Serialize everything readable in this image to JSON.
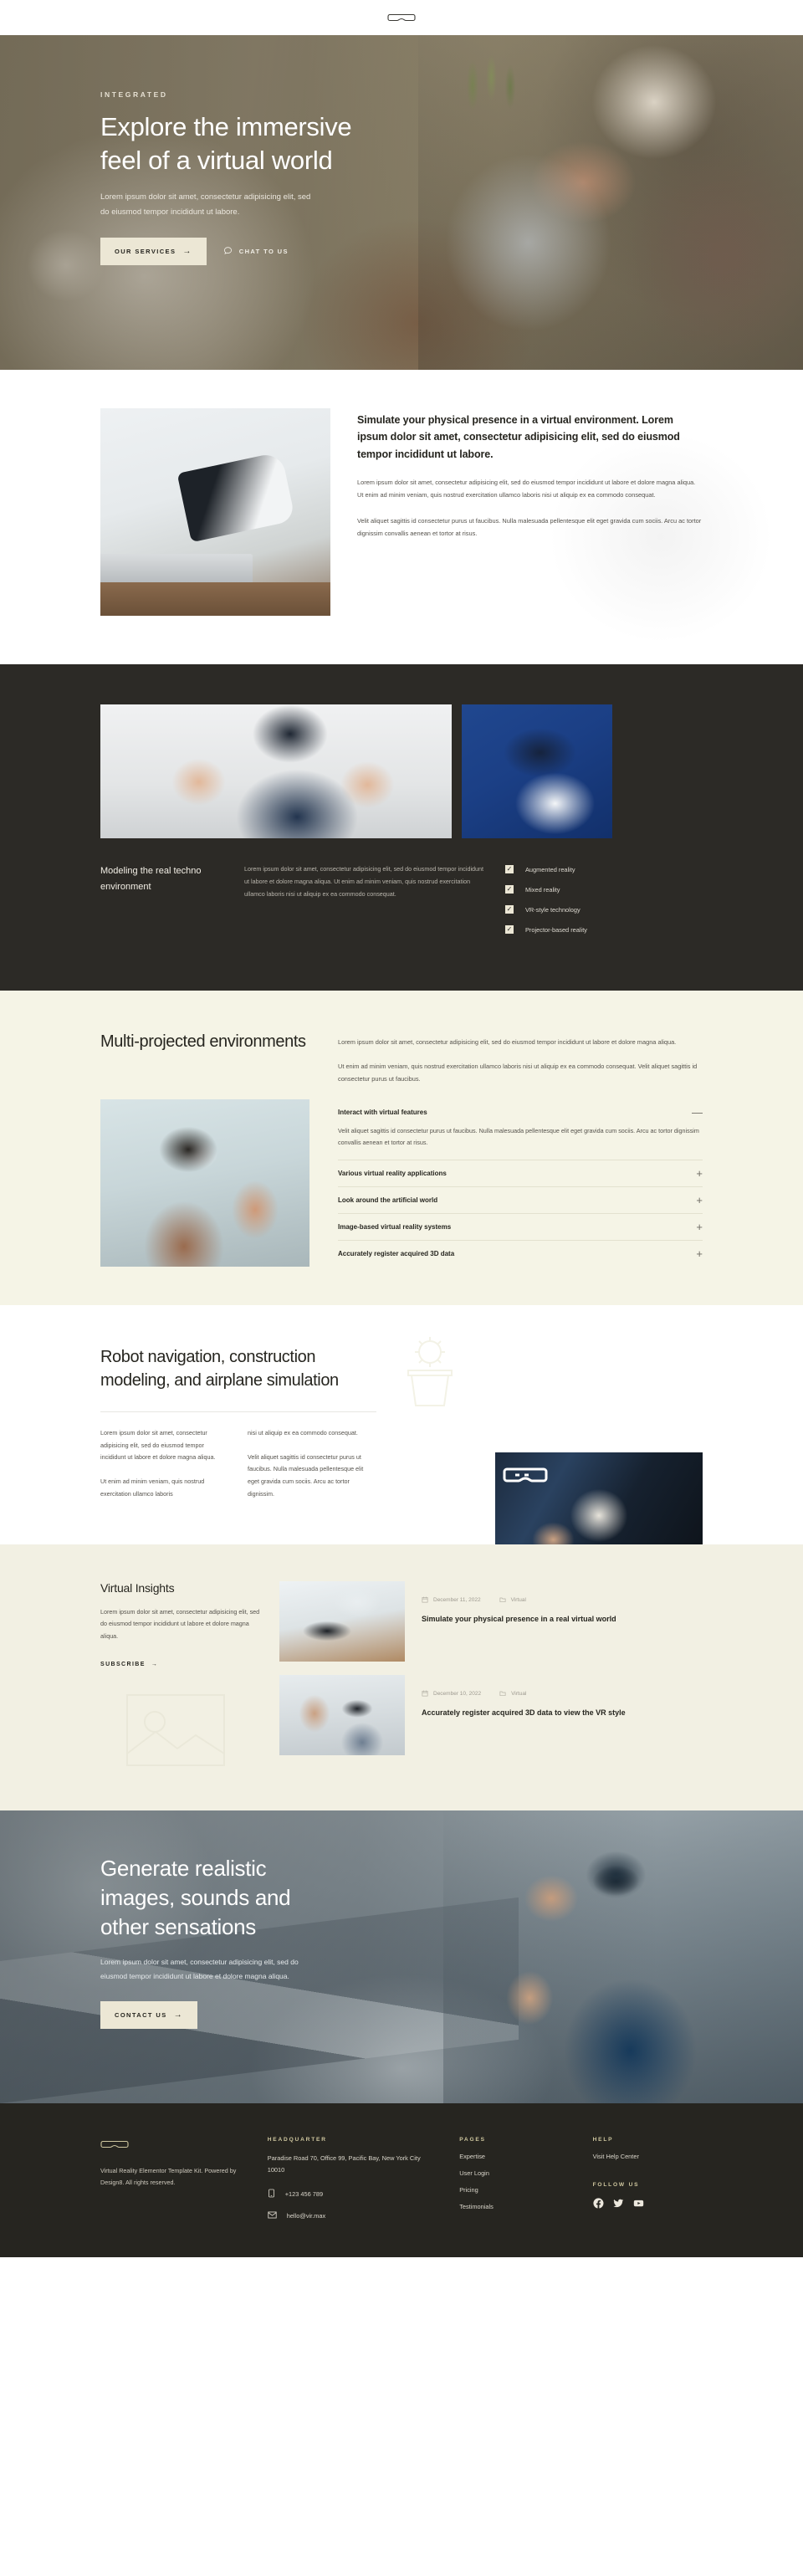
{
  "nav": {
    "logo_icon": "vr-goggles-icon"
  },
  "hero": {
    "eyebrow": "INTEGRATED",
    "title": "Explore the immersive feel of a virtual world",
    "lead": "Lorem ipsum dolor sit amet, consectetur adipisicing elit, sed do eiusmod tempor incididunt ut labore.",
    "primary_button": "OUR SERVICES",
    "chat_label": "CHAT TO US",
    "arrow_icon": "arrow-right-icon",
    "chat_icon": "chat-bubble-icon",
    "button_bg": "#ece7d5"
  },
  "simulate": {
    "heading": "Simulate your physical presence in a virtual environment. Lorem ipsum dolor sit amet, consectetur adipisicing elit, sed do eiusmod tempor incididunt ut labore.",
    "paragraph1": "Lorem ipsum dolor sit amet, consectetur adipisicing elit, sed do eiusmod tempor incididunt ut labore et dolore magna aliqua. Ut enim ad minim veniam, quis nostrud exercitation ullamco laboris nisi ut aliquip ex ea commodo consequat.",
    "paragraph2": "Velit aliquet sagittis id consectetur purus ut faucibus. Nulla malesuada pellentesque elit eget gravida cum sociis. Arcu ac tortor dignissim convallis aenean et tortor at risus.",
    "photo_alt": "hands-holding-vr-headset-at-desk"
  },
  "modeling": {
    "bg": "#2c2a26",
    "heading": "Modeling the real techno environment",
    "paragraph": "Lorem ipsum dolor sit amet, consectetur adipisicing elit, sed do eiusmod tempor incididunt ut labore et dolore magna aliqua. Ut enim ad minim veniam, quis nostrud exercitation ullamco laboris nisi ut aliquip ex ea commodo consequat.",
    "check_icon": "checkmark-icon",
    "checklist": [
      "Augmented reality",
      "Mixed reality",
      "VR-style technology",
      "Projector-based reality"
    ],
    "photo_a_alt": "businessman-wearing-vr-headset",
    "photo_b_alt": "vr-headset-on-blue-background"
  },
  "multi": {
    "bg": "#f5f4e6",
    "title": "Multi-projected environments",
    "paragraph1": "Lorem ipsum dolor sit amet, consectetur adipisicing elit, sed do eiusmod tempor incididunt ut labore et dolore magna aliqua.",
    "paragraph2": "Ut enim ad minim veniam, quis nostrud exercitation ullamco laboris nisi ut aliquip ex ea commodo consequat. Velit aliquet sagittis id consectetur purus ut faucibus.",
    "photo_alt": "man-in-white-vr-headset-reaching",
    "accordion": [
      {
        "label": "Interact with virtual features",
        "sign": "—",
        "open": true,
        "body": "Velit aliquet sagittis id consectetur purus ut faucibus. Nulla malesuada pellentesque elit eget gravida cum sociis. Arcu ac tortor dignissim convallis aenean et tortor at risus."
      },
      {
        "label": "Various virtual reality applications",
        "sign": "+",
        "open": false,
        "body": ""
      },
      {
        "label": "Look around the artificial world",
        "sign": "+",
        "open": false,
        "body": ""
      },
      {
        "label": "Image-based virtual reality systems",
        "sign": "+",
        "open": false,
        "body": ""
      },
      {
        "label": "Accurately register acquired 3D data",
        "sign": "+",
        "open": false,
        "body": ""
      }
    ]
  },
  "robot": {
    "title": "Robot navigation, construction modeling, and airplane simulation",
    "col1_p1": "Lorem ipsum dolor sit amet, consectetur adipisicing elit, sed do eiusmod tempor incididunt ut labore et dolore magna aliqua.",
    "col1_p2": "Ut enim ad minim veniam, quis nostrud exercitation ullamco laboris",
    "col2_p1": "nisi ut aliquip ex ea commodo consequat.",
    "col2_p2": "Velit aliquet sagittis id consectetur purus ut faucibus. Nulla malesuada pellentesque elit eget gravida cum sociis. Arcu ac tortor dignissim.",
    "deco_icon": "plant-outline-icon",
    "photo_deco_icon": "vr-goggles-outline-icon",
    "photo_alt": "person-holding-white-vr-headset"
  },
  "insights": {
    "bg": "#f2f0e3",
    "title": "Virtual Insights",
    "paragraph": "Lorem ipsum dolor sit amet, consectetur adipisicing elit, sed do eiusmod tempor incididunt ut labore et dolore magna aliqua.",
    "subscribe_label": "SUBSCRIBE",
    "arrow_icon": "arrow-right-icon",
    "watermark_icon": "image-placeholder-icon",
    "date_icon": "calendar-icon",
    "category_icon": "folder-icon",
    "posts": [
      {
        "date": "December 11, 2022",
        "category": "Virtual",
        "title": "Simulate your physical presence in a real virtual world",
        "photo_alt": "vr-headset-on-desk"
      },
      {
        "date": "December 10, 2022",
        "category": "Virtual",
        "title": "Accurately register acquired 3D data to view the VR style",
        "photo_alt": "man-in-vr-headset-raising-hand"
      }
    ]
  },
  "cta": {
    "title": "Generate realistic images, sounds and other sensations",
    "paragraph": "Lorem ipsum dolor sit amet, consectetur adipisicing elit, sed do eiusmod tempor incididunt ut labore et dolore magna aliqua.",
    "button": "CONTACT US",
    "arrow_icon": "arrow-right-icon"
  },
  "footer": {
    "bg": "#262520",
    "accent": "#cfc79f",
    "logo_icon": "vr-goggles-icon",
    "copyright": "Virtual Reality Elementor Template Kit. Powered by Design8. All rights reserved.",
    "headquarter_title": "HEADQUARTER",
    "address": "Paradise Road 70, Office 99, Pacific Bay,  New York City 10010",
    "phone": "+123 456 789",
    "phone_icon": "phone-icon",
    "email": "hello@vir.max",
    "email_icon": "envelope-icon",
    "pages_title": "PAGES",
    "pages": [
      "Expertise",
      "User Login",
      "Pricing",
      "Testimonials"
    ],
    "help_title": "HELP",
    "help_link": "Visit Help Center",
    "follow_title": "FOLLOW US",
    "socials": [
      "facebook-icon",
      "twitter-icon",
      "youtube-icon"
    ]
  }
}
